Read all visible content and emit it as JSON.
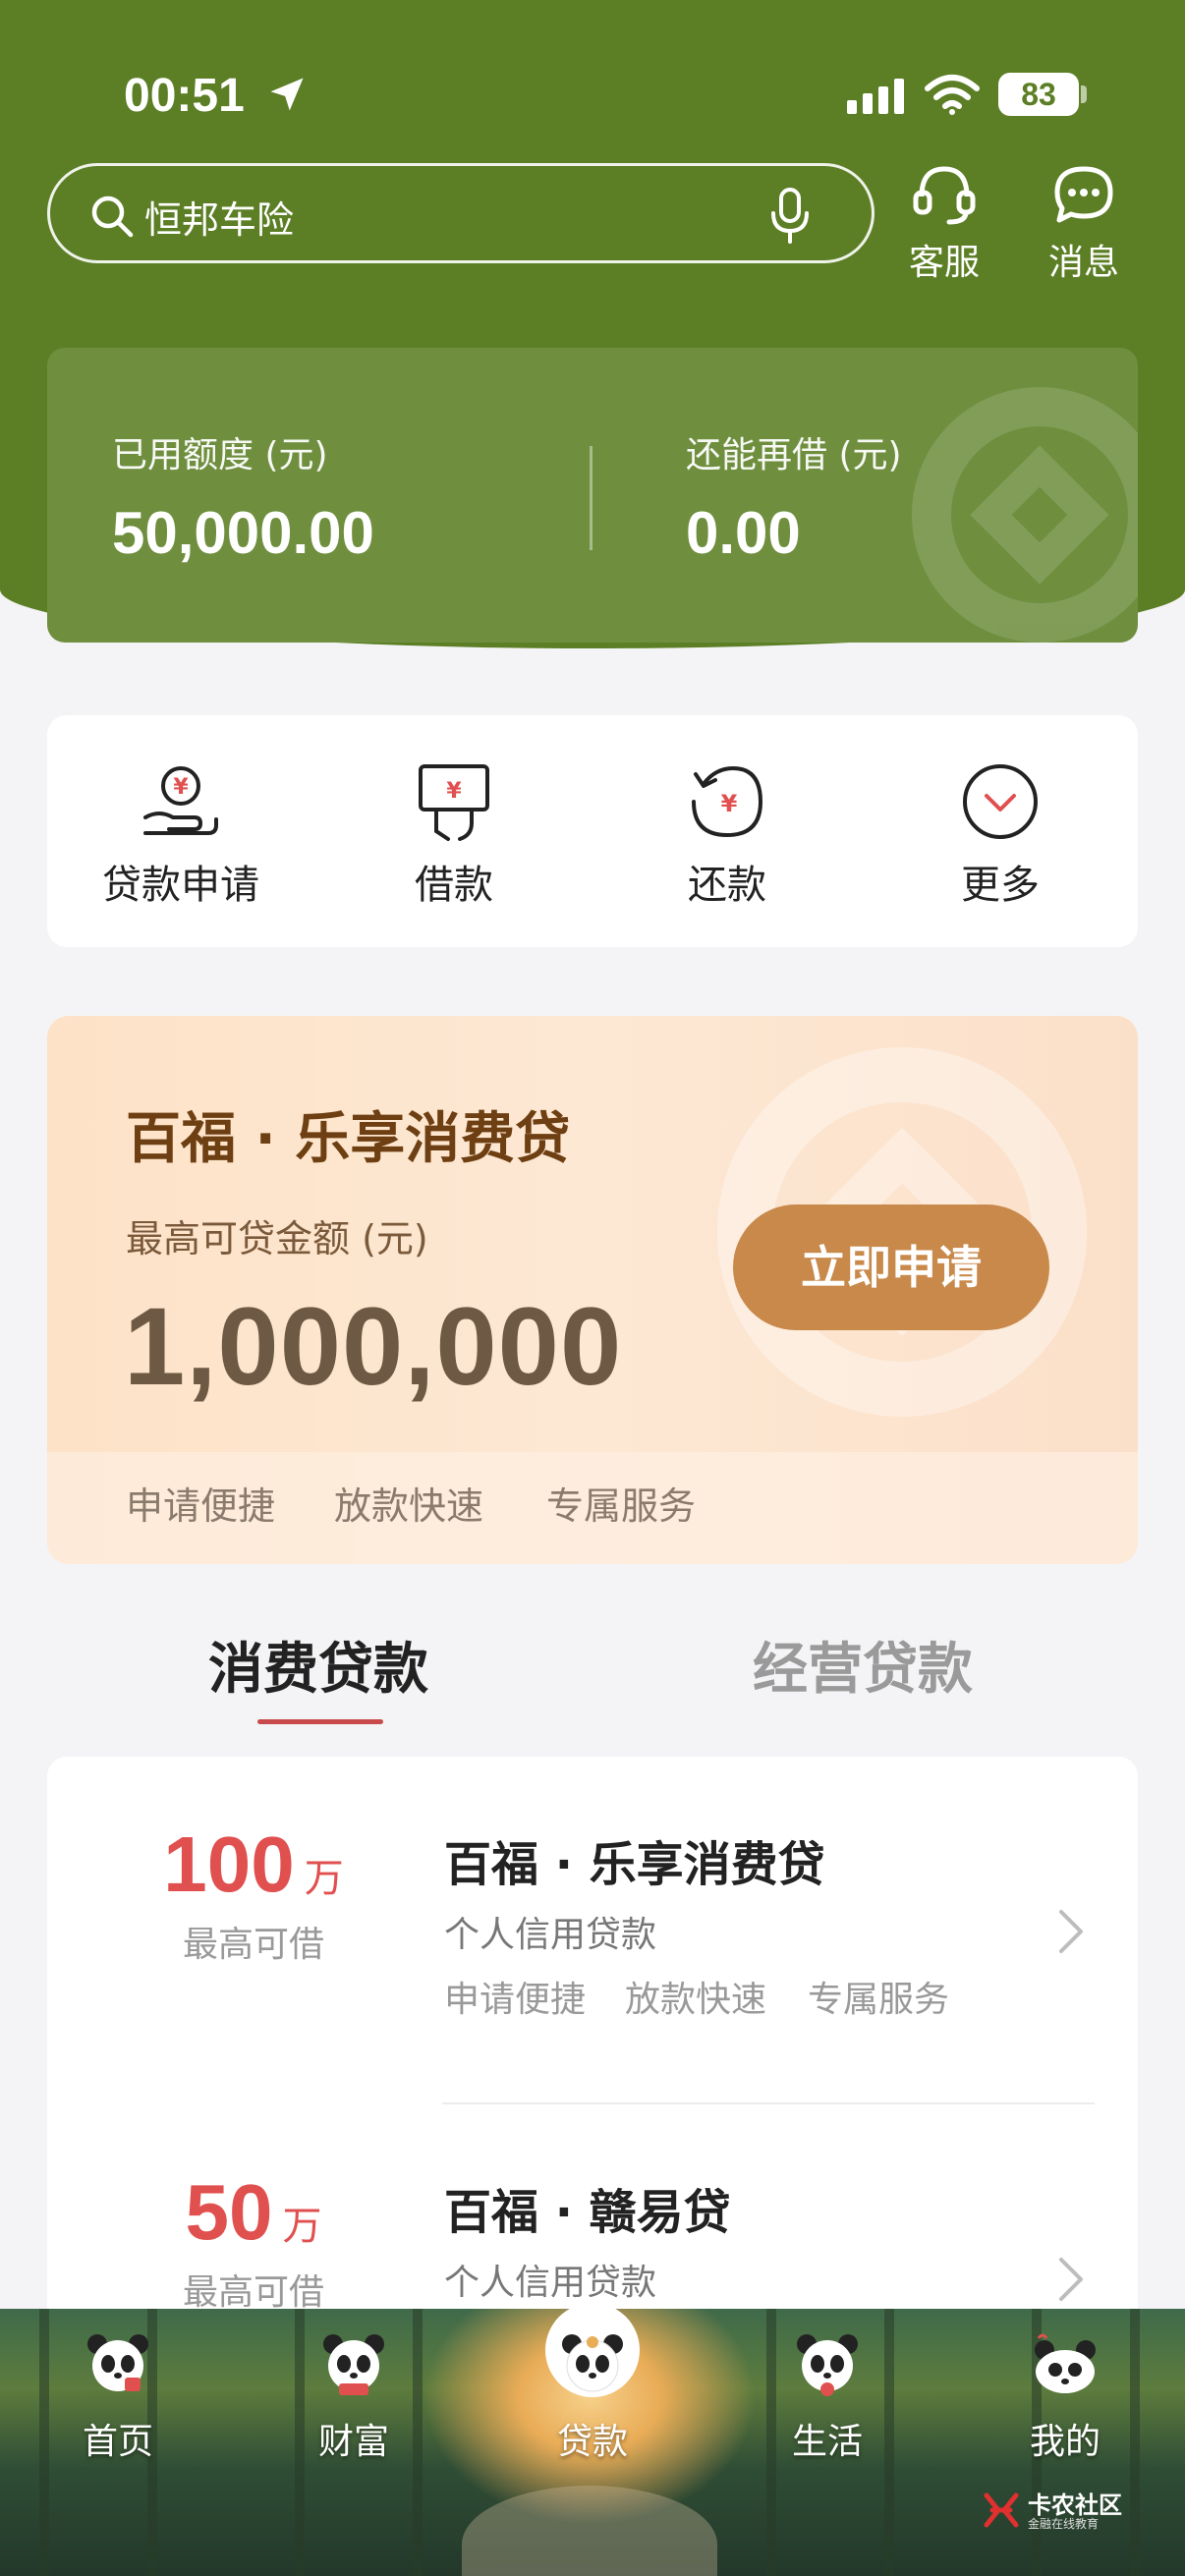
{
  "status_bar": {
    "time": "00:51",
    "battery": "83"
  },
  "header": {
    "search_text": "恒邦车险",
    "customer_service_label": "客服",
    "messages_label": "消息"
  },
  "credit": {
    "used_label": "已用额度 (元)",
    "used_value": "50,000.00",
    "available_label": "还能再借 (元)",
    "available_value": "0.00"
  },
  "quick_actions": [
    {
      "label": "贷款申请",
      "icon": "loan-apply-icon"
    },
    {
      "label": "借款",
      "icon": "borrow-icon"
    },
    {
      "label": "还款",
      "icon": "repay-icon"
    },
    {
      "label": "更多",
      "icon": "more-icon"
    }
  ],
  "promo": {
    "title": "百福 · 乐享消费贷",
    "subtitle": "最高可贷金额 (元)",
    "amount": "1,000,000",
    "button": "立即申请",
    "tags": [
      "申请便捷",
      "放款快速",
      "专属服务"
    ]
  },
  "tabs": [
    {
      "label": "消费贷款",
      "active": true
    },
    {
      "label": "经营贷款",
      "active": false
    }
  ],
  "products": [
    {
      "amount": "100",
      "unit": "万",
      "amount_label": "最高可借",
      "name": "百福 · 乐享消费贷",
      "type": "个人信用贷款",
      "tags": [
        "申请便捷",
        "放款快速",
        "专属服务"
      ]
    },
    {
      "amount": "50",
      "unit": "万",
      "amount_label": "最高可借",
      "name": "百福 · 赣易贷",
      "type": "个人信用贷款",
      "tags": []
    }
  ],
  "tab_bar": [
    {
      "label": "首页"
    },
    {
      "label": "财富"
    },
    {
      "label": "贷款",
      "active": true
    },
    {
      "label": "生活"
    },
    {
      "label": "我的"
    }
  ],
  "watermark": {
    "title": "卡农社区",
    "subtitle": "金融在线教育"
  },
  "colors": {
    "header_green": "#5c7f26",
    "accent_red": "#e0504f",
    "promo_button": "#c8894a"
  }
}
